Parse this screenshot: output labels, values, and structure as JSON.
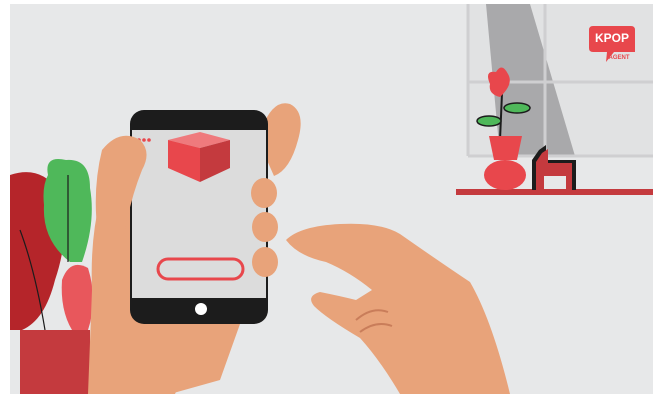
{
  "scene": {
    "description_icon": "illustration-hand-holding-phone",
    "colors": {
      "background": "#e7e8e9",
      "skin": "#e8a37a",
      "accent_red": "#e8474c",
      "dark_red": "#b5252a",
      "green": "#4fb85a",
      "phone_black": "#1c1c1c",
      "phone_screen": "#dcdcdc",
      "window_gray": "#a9a9ab"
    }
  },
  "logo": {
    "line1": "KPOP",
    "line2": "AGENT"
  },
  "phone": {
    "icon": "box-icon",
    "button_label": ""
  }
}
